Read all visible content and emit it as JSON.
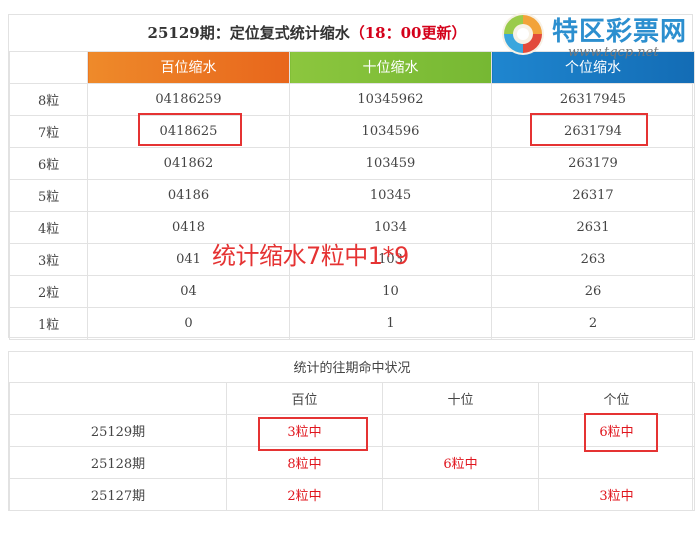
{
  "top": {
    "title_main": "25129期：定位复式统计缩水",
    "title_update": "（18：00更新）",
    "headers": [
      "百位缩水",
      "十位缩水",
      "个位缩水"
    ],
    "rows": [
      {
        "label": "8粒",
        "bai": "04186259",
        "shi": "10345962",
        "ge": "26317945"
      },
      {
        "label": "7粒",
        "bai": "0418625",
        "shi": "1034596",
        "ge": "2631794"
      },
      {
        "label": "6粒",
        "bai": "041862",
        "shi": "103459",
        "ge": "263179"
      },
      {
        "label": "5粒",
        "bai": "04186",
        "shi": "10345",
        "ge": "26317"
      },
      {
        "label": "4粒",
        "bai": "0418",
        "shi": "1034",
        "ge": "2631"
      },
      {
        "label": "3粒",
        "bai": "041",
        "shi": "103",
        "ge": "263"
      },
      {
        "label": "2粒",
        "bai": "04",
        "shi": "10",
        "ge": "26"
      },
      {
        "label": "1粒",
        "bai": "0",
        "shi": "1",
        "ge": "2"
      }
    ]
  },
  "logo": {
    "name": "特区彩票网",
    "url": "www.tqcp.net",
    "colors": {
      "brand": "#2c8fcf",
      "swirl": [
        "#f2a33a",
        "#e24a3b",
        "#3aa6dd"
      ]
    }
  },
  "annotation": {
    "text": "统计缩水7粒中1*9",
    "color": "#e53333"
  },
  "bottom": {
    "title": "统计的往期命中状况",
    "headers": [
      "百位",
      "十位",
      "个位"
    ],
    "rows": [
      {
        "period": "25129期",
        "bai": "3粒中",
        "shi": "",
        "ge": "6粒中"
      },
      {
        "period": "25128期",
        "bai": "8粒中",
        "shi": "6粒中",
        "ge": ""
      },
      {
        "period": "25127期",
        "bai": "2粒中",
        "shi": "",
        "ge": "3粒中"
      }
    ]
  },
  "colors": {
    "bai": "#e8661c",
    "shi": "#76b833",
    "ge": "#136cb5",
    "hit": "#e0151d"
  }
}
